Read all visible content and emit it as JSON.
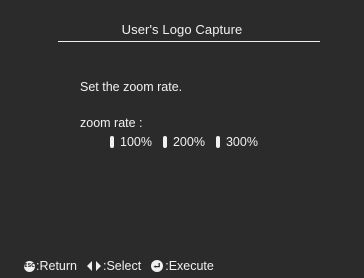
{
  "dialog": {
    "title": "User's Logo Capture",
    "instruction": "Set the zoom rate.",
    "zoom_label": "zoom rate :",
    "options": [
      {
        "label": "100%"
      },
      {
        "label": "200%"
      },
      {
        "label": "300%"
      }
    ]
  },
  "footer": {
    "esc_glyph": "ESC",
    "return_label": ":Return",
    "select_label": ":Select",
    "execute_label": ":Execute"
  },
  "colors": {
    "background": "#2b2b2b",
    "text": "#f0f0f0"
  }
}
